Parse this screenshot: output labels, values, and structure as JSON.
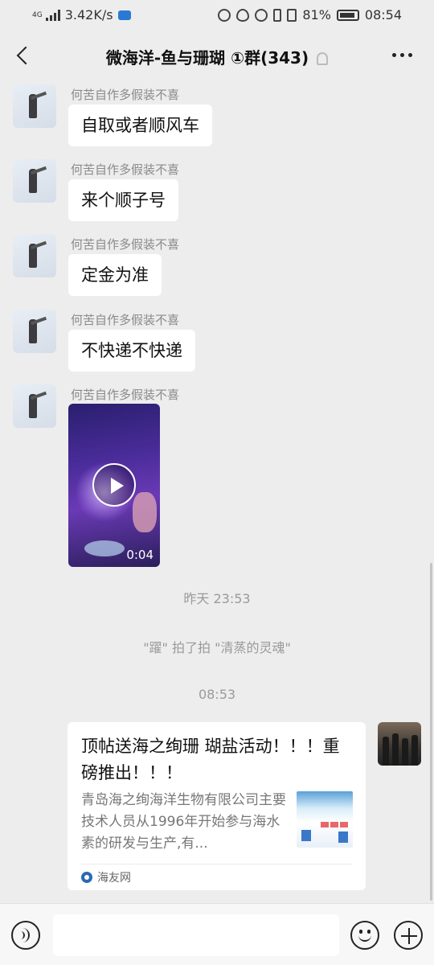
{
  "status_bar": {
    "network": "4G",
    "speed": "3.42K/s",
    "battery": "81%",
    "time": "08:54"
  },
  "header": {
    "title": "微海洋-鱼与珊瑚 ①群(343)"
  },
  "messages": [
    {
      "sender": "何苦自作多假装不喜",
      "text": "自取或者顺风车"
    },
    {
      "sender": "何苦自作多假装不喜",
      "text": "来个顺子号"
    },
    {
      "sender": "何苦自作多假装不喜",
      "text": "定金为准"
    },
    {
      "sender": "何苦自作多假装不喜",
      "text": "不快递不快递"
    },
    {
      "sender": "何苦自作多假装不喜",
      "video_duration": "0:04"
    }
  ],
  "timestamps": {
    "first": "昨天 23:53",
    "second": "08:53"
  },
  "system_notice": "\"躍\" 拍了拍 \"清蒸的灵魂\"",
  "link_card": {
    "title": "顶帖送海之绚珊 瑚盐活动！！！重磅推出！！！",
    "description": "青岛海之绚海洋生物有限公司主要技术人员从1996年开始参与海水素的研发与生产,有...",
    "source": "海友网"
  },
  "icons": {
    "back": "back-arrow-icon",
    "mute": "bell-mute-icon",
    "more": "more-icon",
    "play": "play-icon",
    "voice": "voice-icon",
    "emoji": "emoji-icon",
    "plus": "plus-icon"
  }
}
